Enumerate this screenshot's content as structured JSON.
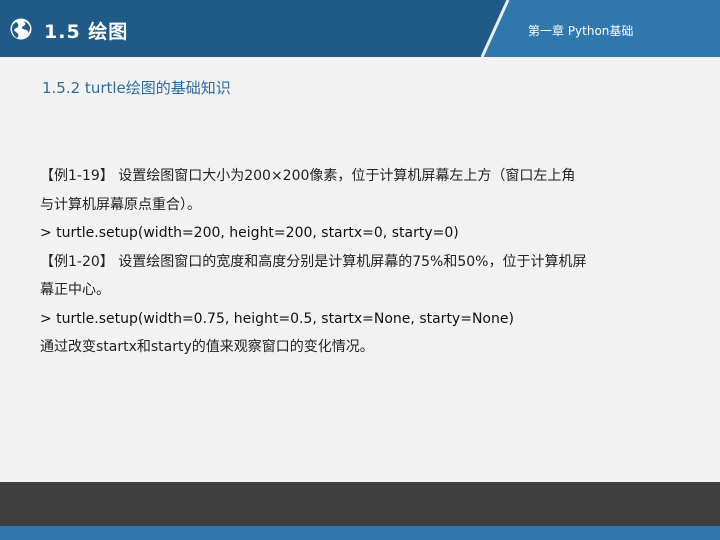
{
  "header": {
    "section_title": "1.5 绘图",
    "chapter_label": "第一章 Python基础",
    "logo_icon": "globe-icon"
  },
  "subtitle": "1.5.2 turtle绘图的基础知识",
  "content": {
    "lines": [
      "【例1-19】 设置绘图窗口大小为200×200像素，位于计算机屏幕左上方（窗口左上角",
      "与计算机屏幕原点重合）。",
      "> turtle.setup(width=200, height=200, startx=0, starty=0)",
      "【例1-20】 设置绘图窗口的宽度和高度分别是计算机屏幕的75%和50%，位于计算机屏",
      "幕正中心。",
      "> turtle.setup(width=0.75, height=0.5, startx=None, starty=None)",
      "通过改变startx和starty的值来观察窗口的变化情况。"
    ]
  },
  "colors": {
    "header_blue": "#2e78ad",
    "header_dark": "#1f5b86",
    "subtitle": "#2d6a9c",
    "footer_dark": "#3f3f3f"
  }
}
